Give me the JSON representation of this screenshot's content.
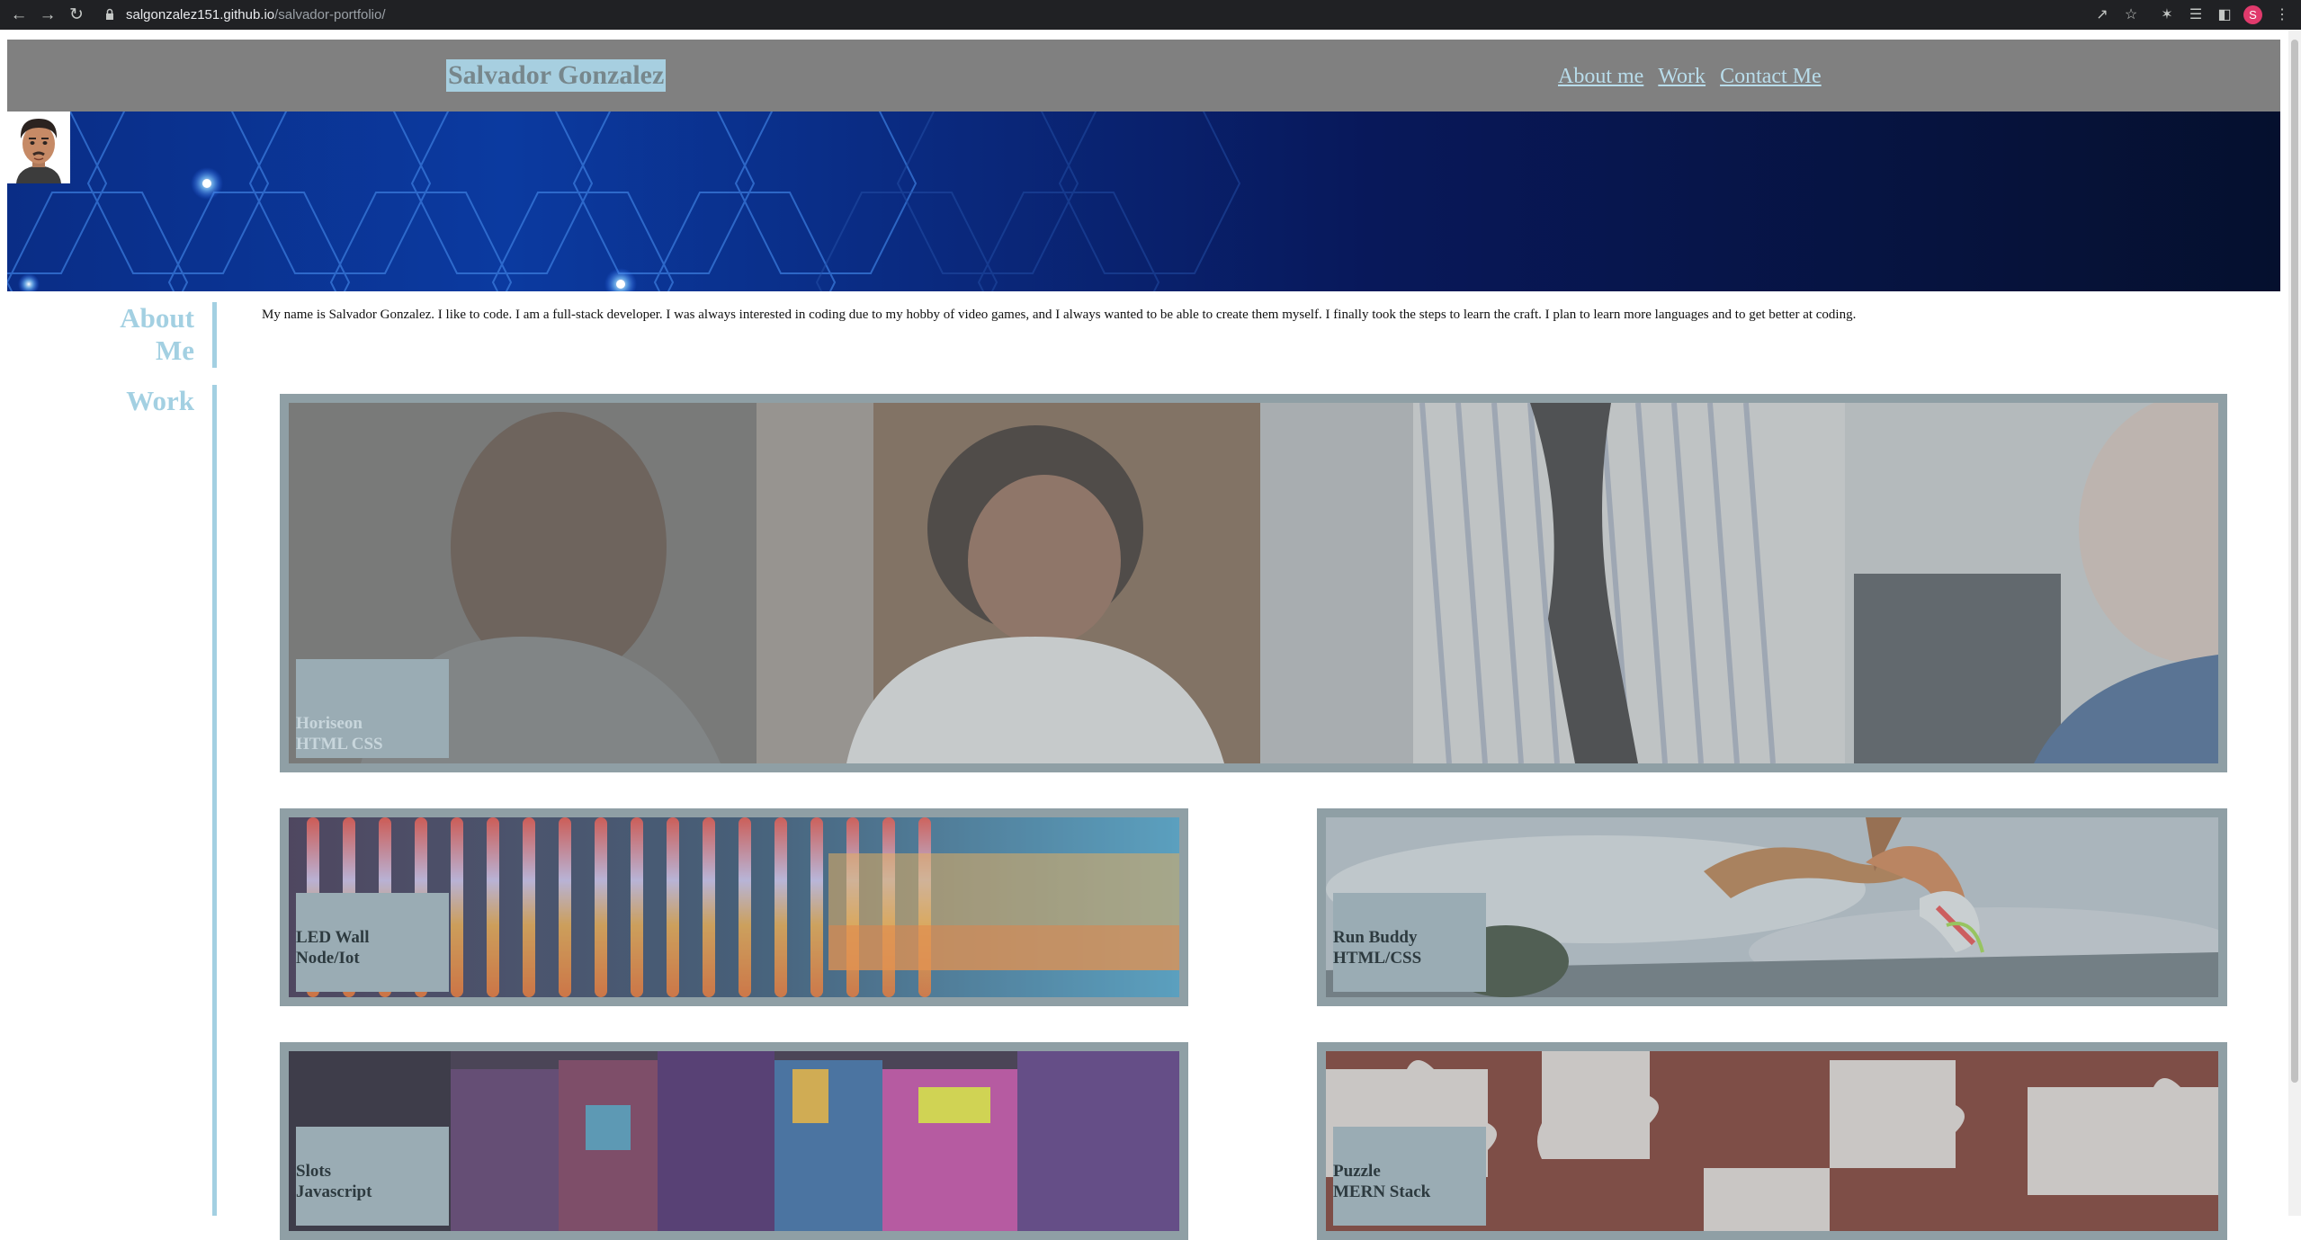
{
  "browser": {
    "url_host": "salgonzalez151.github.io",
    "url_path": "/salvador-portfolio/",
    "profile_initial": "S"
  },
  "header": {
    "title": "Salvador Gonzalez",
    "nav": [
      "About me",
      "Work",
      "Contact Me"
    ]
  },
  "sidebar": {
    "about_line1": "About",
    "about_line2": "Me",
    "work": "Work"
  },
  "about": {
    "text": "My name is Salvador Gonzalez. I like to code. I am a full-stack developer. I was always interested in coding due to my hobby of video games, and I always wanted to be able to create them myself. I finally took the steps to learn the craft. I plan to learn more languages and to get better at coding."
  },
  "work": {
    "projects": [
      {
        "name": "Horiseon",
        "tech": "HTML CSS"
      },
      {
        "name": "LED Wall",
        "tech": "Node/Iot"
      },
      {
        "name": "Run Buddy",
        "tech": "HTML/CSS"
      },
      {
        "name": "Slots",
        "tech": "Javascript"
      },
      {
        "name": "Puzzle",
        "tech": "MERN Stack"
      }
    ]
  },
  "colors": {
    "header_bg": "#808080",
    "accent": "#a3d0e2",
    "card_border": "#8f9fa5"
  }
}
